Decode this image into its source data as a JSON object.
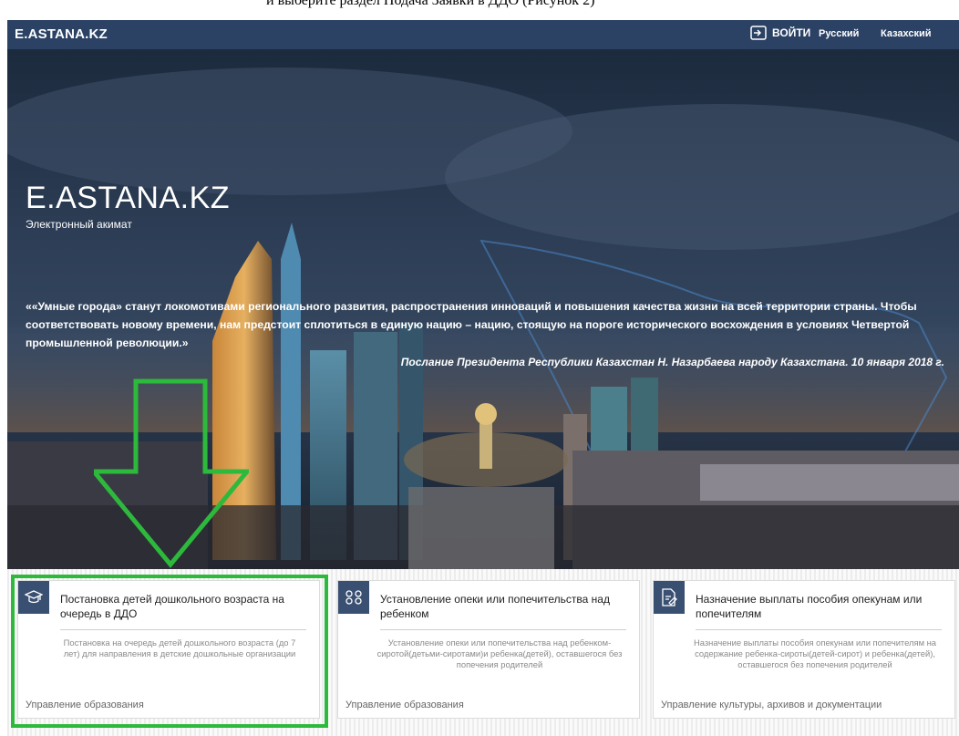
{
  "caption": "и выберите раздел Подача Заявки в ДДО (Рисунок 2)",
  "header": {
    "logo": "E.ASTANA.KZ",
    "login_label": "ВОЙТИ",
    "lang_ru": "Русский",
    "lang_kz": "Казахский",
    "bg_color": "#2b4265"
  },
  "hero": {
    "title": "E.ASTANA.KZ",
    "subtitle": "Электронный акимат",
    "quote": "««Умные города» станут локомотивами регионального развития, распространения инноваций и повышения качества жизни на всей территории страны. Чтобы соответствовать новому времени, нам предстоит сплотиться в единую нацию – нацию, стоящую на пороге исторического восхождения в условиях Четвертой промышленной революции.»",
    "quote_source": "Послание Президента Республики Казахстан Н. Назарбаева народу Казахстана. 10 января 2018 г."
  },
  "annotation": {
    "color": "#2db93c",
    "arrow": "arrow-down-icon"
  },
  "cards": [
    {
      "icon": "graduation-cap-icon",
      "title": "Постановка детей дошкольного возраста на очередь в ДДО",
      "description": "Постановка на очередь детей дошкольного возраста (до 7 лет) для направления в детские дошкольные организации",
      "department": "Управление образования"
    },
    {
      "icon": "people-icon",
      "title": "Установление опеки или попечительства над ребенком",
      "description": "Установление опеки или попечительства над ребенком-сиротой(детьми-сиротами)и ребенка(детей), оставшегося без попечения родителей",
      "department": "Управление образования"
    },
    {
      "icon": "document-edit-icon",
      "title": "Назначение выплаты пособия опекунам или попечителям",
      "description": "Назначение выплаты пособия опекунам или попечителям на содержание ребенка-сироты(детей-сирот) и ребенка(детей), оставшегося без попечения родителей",
      "department": "Управление культуры, архивов и документации"
    }
  ]
}
